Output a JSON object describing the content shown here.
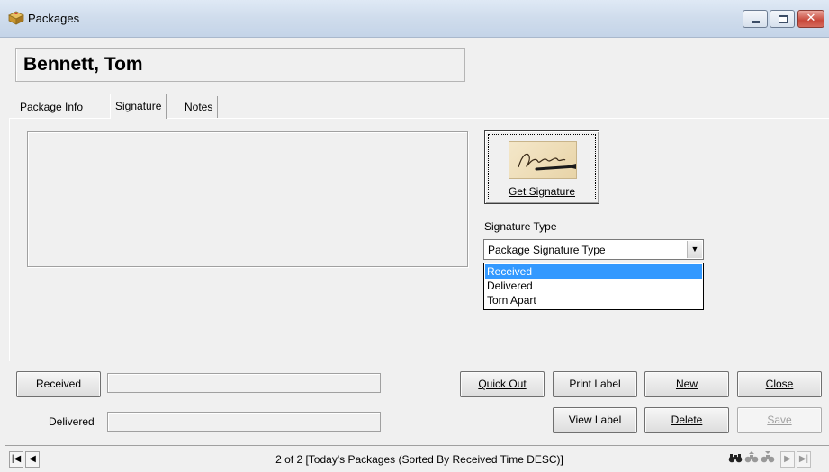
{
  "window": {
    "title": "Packages",
    "controls": [
      "minimize-icon",
      "maximize-icon",
      "close-icon"
    ]
  },
  "record": {
    "name": "Bennett, Tom"
  },
  "tabs": [
    {
      "label": "Package Info",
      "active": false
    },
    {
      "label": "Signature",
      "active": true
    },
    {
      "label": "Notes",
      "active": false
    }
  ],
  "signature": {
    "get_button_label": "Get Signature",
    "type_label": "Signature Type",
    "type_value": "Package Signature Type",
    "options": [
      "Received",
      "Delivered",
      "Torn Apart"
    ],
    "selected_option": "Received"
  },
  "actions": {
    "received": "Received",
    "delivered_label": "Delivered",
    "quick_out": "Quick Out",
    "print_label": "Print Label",
    "new": "New",
    "close": "Close",
    "view_label": "View Label",
    "delete": "Delete",
    "save": "Save"
  },
  "navigation": {
    "status": "2 of 2 [Today's Packages (Sorted By Received Time DESC)]",
    "icons": [
      "first-record-icon",
      "prev-record-icon",
      "find-icon",
      "find-next-icon",
      "find-prev-icon",
      "next-record-icon",
      "last-record-icon"
    ]
  },
  "colors": {
    "selection": "#3399ff",
    "titlebar": "#cfdcec",
    "close_button": "#c8483a"
  }
}
